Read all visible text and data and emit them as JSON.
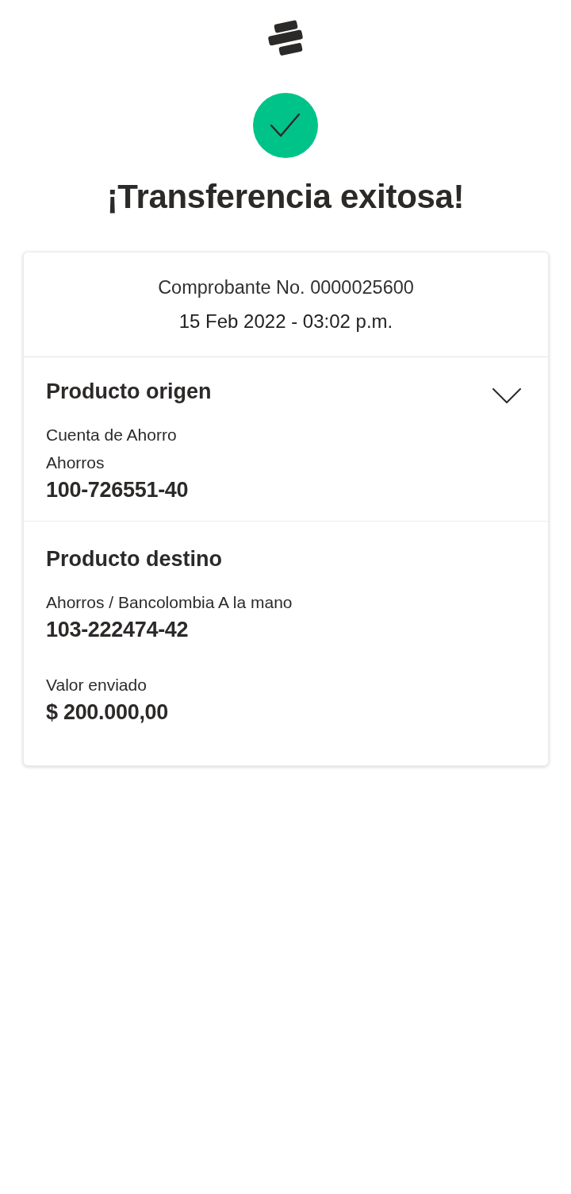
{
  "status": {
    "kind": "success",
    "title": "¡Transferencia exitosa!"
  },
  "receipt": {
    "number": "Comprobante No. 0000025600",
    "datetime": "15 Feb 2022 - 03:02 p.m."
  },
  "sections": [
    {
      "title": "Producto origen",
      "expandable": true,
      "groups": [
        {
          "lines": [
            {
              "kind": "label",
              "text": "Cuenta de Ahorro"
            },
            {
              "kind": "label",
              "text": "Ahorros"
            },
            {
              "kind": "value",
              "text": "100-726551-40"
            }
          ]
        }
      ]
    },
    {
      "title": "Producto destino",
      "expandable": false,
      "groups": [
        {
          "lines": [
            {
              "kind": "label",
              "text": "Ahorros / Bancolombia A la mano"
            },
            {
              "kind": "value",
              "text": "103-222474-42"
            }
          ]
        },
        {
          "lines": [
            {
              "kind": "label",
              "text": "Valor enviado"
            },
            {
              "kind": "value",
              "text": "$ 200.000,00"
            }
          ]
        }
      ]
    }
  ]
}
